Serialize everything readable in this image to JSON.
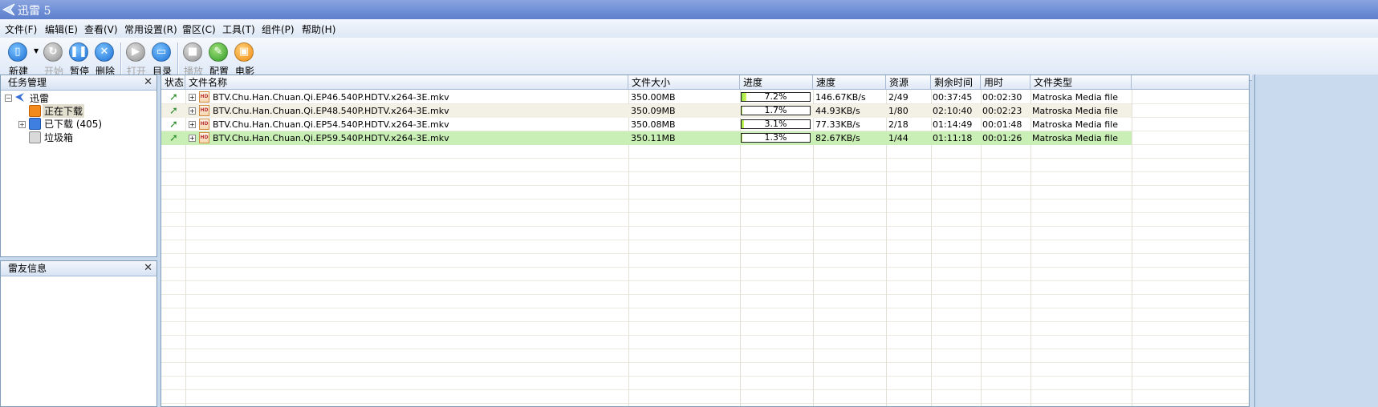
{
  "window": {
    "title": "迅雷 5",
    "app_icon": "thunder-bird-icon"
  },
  "menu": [
    {
      "label": "文件(F)"
    },
    {
      "label": "编辑(E)"
    },
    {
      "label": "查看(V)"
    },
    {
      "label": "常用设置(R)"
    },
    {
      "label": "雷区(C)"
    },
    {
      "label": "工具(T)"
    },
    {
      "label": "组件(P)"
    },
    {
      "label": "帮助(H)"
    }
  ],
  "toolbar": {
    "new": {
      "label": "新建",
      "icon": "new-file-icon",
      "enabled": true
    },
    "start": {
      "label": "开始",
      "icon": "start-icon",
      "enabled": false
    },
    "pause": {
      "label": "暂停",
      "icon": "pause-icon",
      "enabled": true
    },
    "delete": {
      "label": "删除",
      "icon": "delete-icon",
      "enabled": true
    },
    "open": {
      "label": "打开",
      "icon": "open-icon",
      "enabled": false
    },
    "folder": {
      "label": "目录",
      "icon": "folder-icon",
      "enabled": true
    },
    "play": {
      "label": "播放",
      "icon": "play-icon",
      "enabled": false
    },
    "config": {
      "label": "配置",
      "icon": "config-icon",
      "enabled": true
    },
    "movie": {
      "label": "电影",
      "icon": "movie-icon",
      "enabled": true
    }
  },
  "task_panel": {
    "title": "任务管理",
    "root": "迅雷",
    "items": {
      "downloading": "正在下载",
      "downloaded": "已下载 (405)",
      "trash": "垃圾箱"
    }
  },
  "friend_panel": {
    "title": "雷友信息"
  },
  "columns": {
    "status": "状态",
    "name": "文件名称",
    "size": "文件大小",
    "progress": "进度",
    "speed": "速度",
    "sources": "资源",
    "remaining": "剩余时间",
    "elapsed": "用时",
    "type": "文件类型"
  },
  "tasks": [
    {
      "name": "BTV.Chu.Han.Chuan.Qi.EP46.540P.HDTV.x264-3E.mkv",
      "size": "350.00MB",
      "progress_label": "7.2%",
      "progress": 0.072,
      "speed": "146.67KB/s",
      "sources": "2/49",
      "remaining": "00:37:45",
      "elapsed": "00:02:30",
      "type": "Matroska Media file"
    },
    {
      "name": "BTV.Chu.Han.Chuan.Qi.EP48.540P.HDTV.x264-3E.mkv",
      "size": "350.09MB",
      "progress_label": "1.7%",
      "progress": 0.017,
      "speed": "44.93KB/s",
      "sources": "1/80",
      "remaining": "02:10:40",
      "elapsed": "00:02:23",
      "type": "Matroska Media file"
    },
    {
      "name": "BTV.Chu.Han.Chuan.Qi.EP54.540P.HDTV.x264-3E.mkv",
      "size": "350.08MB",
      "progress_label": "3.1%",
      "progress": 0.031,
      "speed": "77.33KB/s",
      "sources": "2/18",
      "remaining": "01:14:49",
      "elapsed": "00:01:48",
      "type": "Matroska Media file"
    },
    {
      "name": "BTV.Chu.Han.Chuan.Qi.EP59.540P.HDTV.x264-3E.mkv",
      "size": "350.11MB",
      "progress_label": "1.3%",
      "progress": 0.013,
      "speed": "82.67KB/s",
      "sources": "1/44",
      "remaining": "01:11:18",
      "elapsed": "00:01:26",
      "type": "Matroska Media file"
    }
  ],
  "colors": {
    "selected_row": "#c9efb6",
    "alt_row": "#f3f1e6",
    "progress_fill": "#8fe64a",
    "titlebar": "#6f8fd6"
  }
}
